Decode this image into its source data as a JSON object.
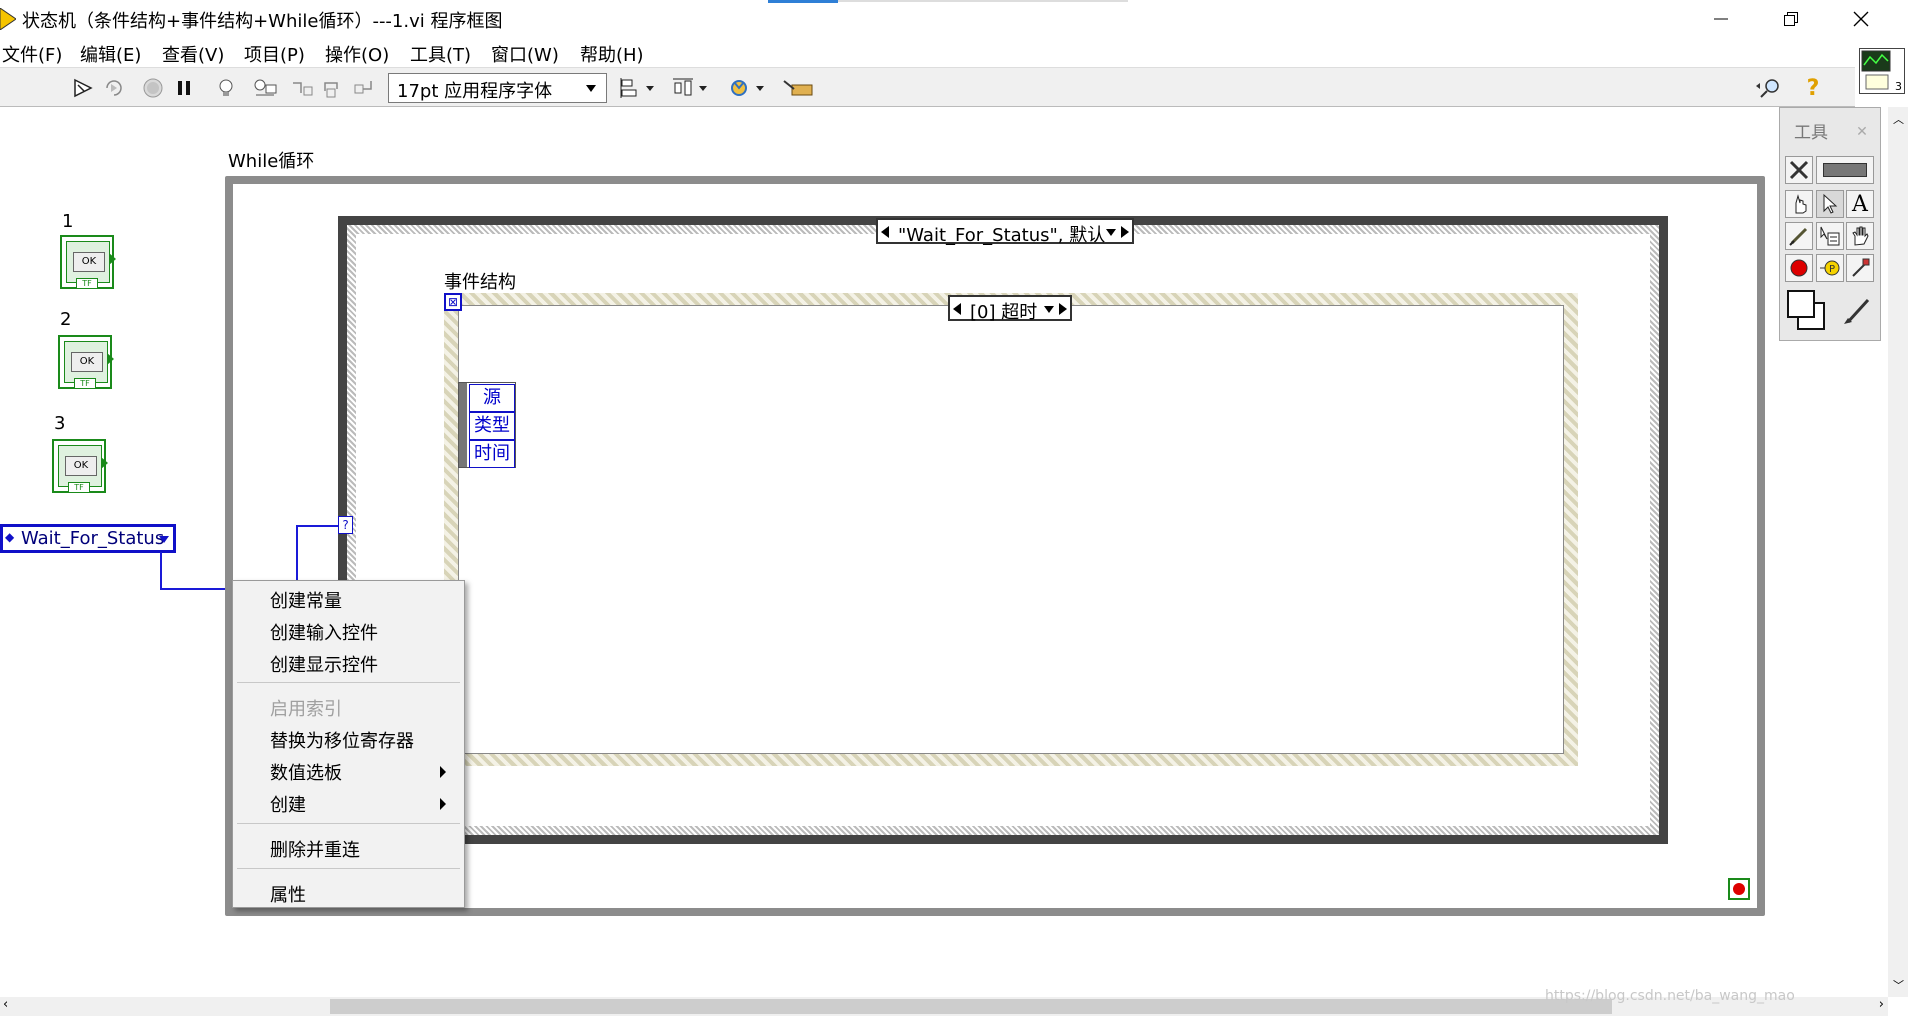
{
  "window": {
    "title": "状态机（条件结构+事件结构+While循环）---1.vi 程序框图",
    "minimize_glyph": "—",
    "restore_glyph": "❐",
    "close_glyph": "✕"
  },
  "menu": [
    "文件(F)",
    "编辑(E)",
    "查看(V)",
    "项目(P)",
    "操作(O)",
    "工具(T)",
    "窗口(W)",
    "帮助(H)"
  ],
  "toolbar": {
    "font_value": "17pt 应用程序字体",
    "icons": [
      "run-arrow-icon",
      "run-continuous-icon",
      "abort-icon",
      "pause-icon",
      "highlight-execution-icon",
      "retain-wire-values-icon",
      "step-into-icon",
      "step-over-icon",
      "step-out-icon",
      "align-icon",
      "distribute-icon",
      "reorder-icon",
      "cleanup-icon",
      "search-icon",
      "help-icon"
    ],
    "vi_icon_badge": "3"
  },
  "diagram": {
    "while_label": "While循环",
    "event_label": "事件结构",
    "case_selector": "\"Wait_For_Status\", 默认",
    "event_selector": "[0] 超时",
    "event_data": [
      "源",
      "类型",
      "时间"
    ],
    "buttons": [
      {
        "label": "1",
        "text": "OK",
        "tf": "TF"
      },
      {
        "label": "2",
        "text": "OK",
        "tf": "TF"
      },
      {
        "label": "3",
        "text": "OK",
        "tf": "TF"
      }
    ],
    "enum_value": "Wait_For_Status",
    "case_selector_terminal": "?",
    "event_timeout_glyph": "⊠"
  },
  "context_menu": {
    "items": [
      "创建常量",
      "创建输入控件",
      "创建显示控件"
    ],
    "disabled_item": "启用索引",
    "items2": [
      "替换为移位寄存器",
      "数值选板",
      "创建"
    ],
    "items3": [
      "删除并重连"
    ],
    "items4": [
      "属性"
    ]
  },
  "palette": {
    "title": "工具"
  },
  "watermark": "https://blog.csdn.net/ba_wang_mao",
  "colors": {
    "wire": "#1a1ad8",
    "boolean_green": "#1a8a1a",
    "enum_blue": "#1010c8"
  }
}
